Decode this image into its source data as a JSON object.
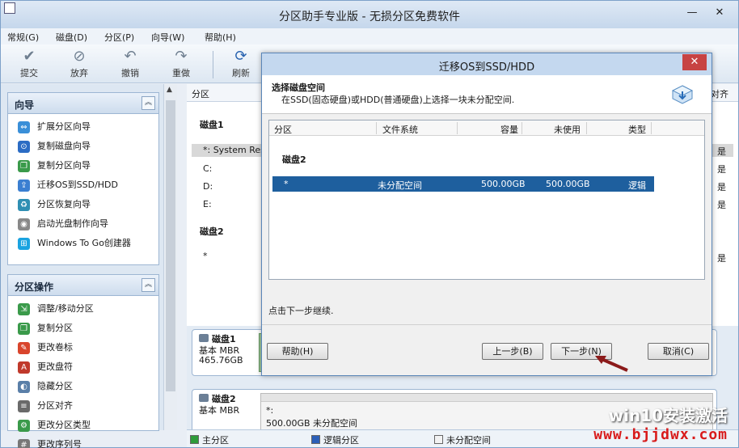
{
  "window": {
    "title": "分区助手专业版 - 无损分区免费软件",
    "minimize": "—",
    "close": "✕"
  },
  "menu": [
    "常规(G)",
    "磁盘(D)",
    "分区(P)",
    "向导(W)",
    "帮助(H)"
  ],
  "toolbar": [
    {
      "label": "提交",
      "icon": "check-icon"
    },
    {
      "label": "放弃",
      "icon": "discard-icon"
    },
    {
      "label": "撤销",
      "icon": "undo-icon"
    },
    {
      "label": "重做",
      "icon": "redo-icon"
    },
    {
      "label": "刷新",
      "icon": "refresh-icon"
    }
  ],
  "wizard_group": {
    "title": "向导",
    "items": [
      "扩展分区向导",
      "复制磁盘向导",
      "复制分区向导",
      "迁移OS到SSD/HDD",
      "分区恢复向导",
      "启动光盘制作向导",
      "Windows To Go创建器"
    ]
  },
  "ops_group": {
    "title": "分区操作",
    "items": [
      "调整/移动分区",
      "复制分区",
      "更改卷标",
      "更改盘符",
      "隐藏分区",
      "分区对齐",
      "更改分区类型",
      "更改序列号"
    ]
  },
  "background": {
    "col_partition": "分区",
    "col_align": "对齐",
    "disk1": "磁盘1",
    "disk2": "磁盘2",
    "row_sysres": "*: System Rese",
    "row_c": "C:",
    "row_d": "D:",
    "row_e": "E:",
    "row_star": "*",
    "yes": "是",
    "card1_name": "磁盘1",
    "card1_type": "基本 MBR",
    "card1_size": "465.76GB",
    "card2_name": "磁盘2",
    "card2_type": "基本 MBR",
    "card2_part": "*:",
    "card2_unalloc": "500.00GB 未分配空间"
  },
  "legend": [
    "主分区",
    "逻辑分区",
    "未分配空间"
  ],
  "colors": {
    "primary": "#2e9b3a",
    "logical": "#2b5fb8",
    "unallocated": "#f2f2f2",
    "selection": "#1e5f9e"
  },
  "dialog": {
    "title": "迁移OS到SSD/HDD",
    "close": "✕",
    "header_title": "选择磁盘空间",
    "header_desc": "在SSD(固态硬盘)或HDD(普通硬盘)上选择一块未分配空间.",
    "columns": [
      "分区",
      "文件系统",
      "容量",
      "未使用",
      "类型"
    ],
    "group": "磁盘2",
    "row": {
      "partition": "*",
      "fs": "未分配空间",
      "capacity": "500.00GB",
      "free": "500.00GB",
      "type": "逻辑"
    },
    "hint": "点击下一步继续.",
    "buttons": {
      "help": "帮助(H)",
      "prev": "上一步(B)",
      "next": "下一步(N)",
      "cancel": "取消(C)"
    }
  },
  "watermark": {
    "line1": "win10安装激活",
    "line2": "www.bjjdwx.com"
  }
}
